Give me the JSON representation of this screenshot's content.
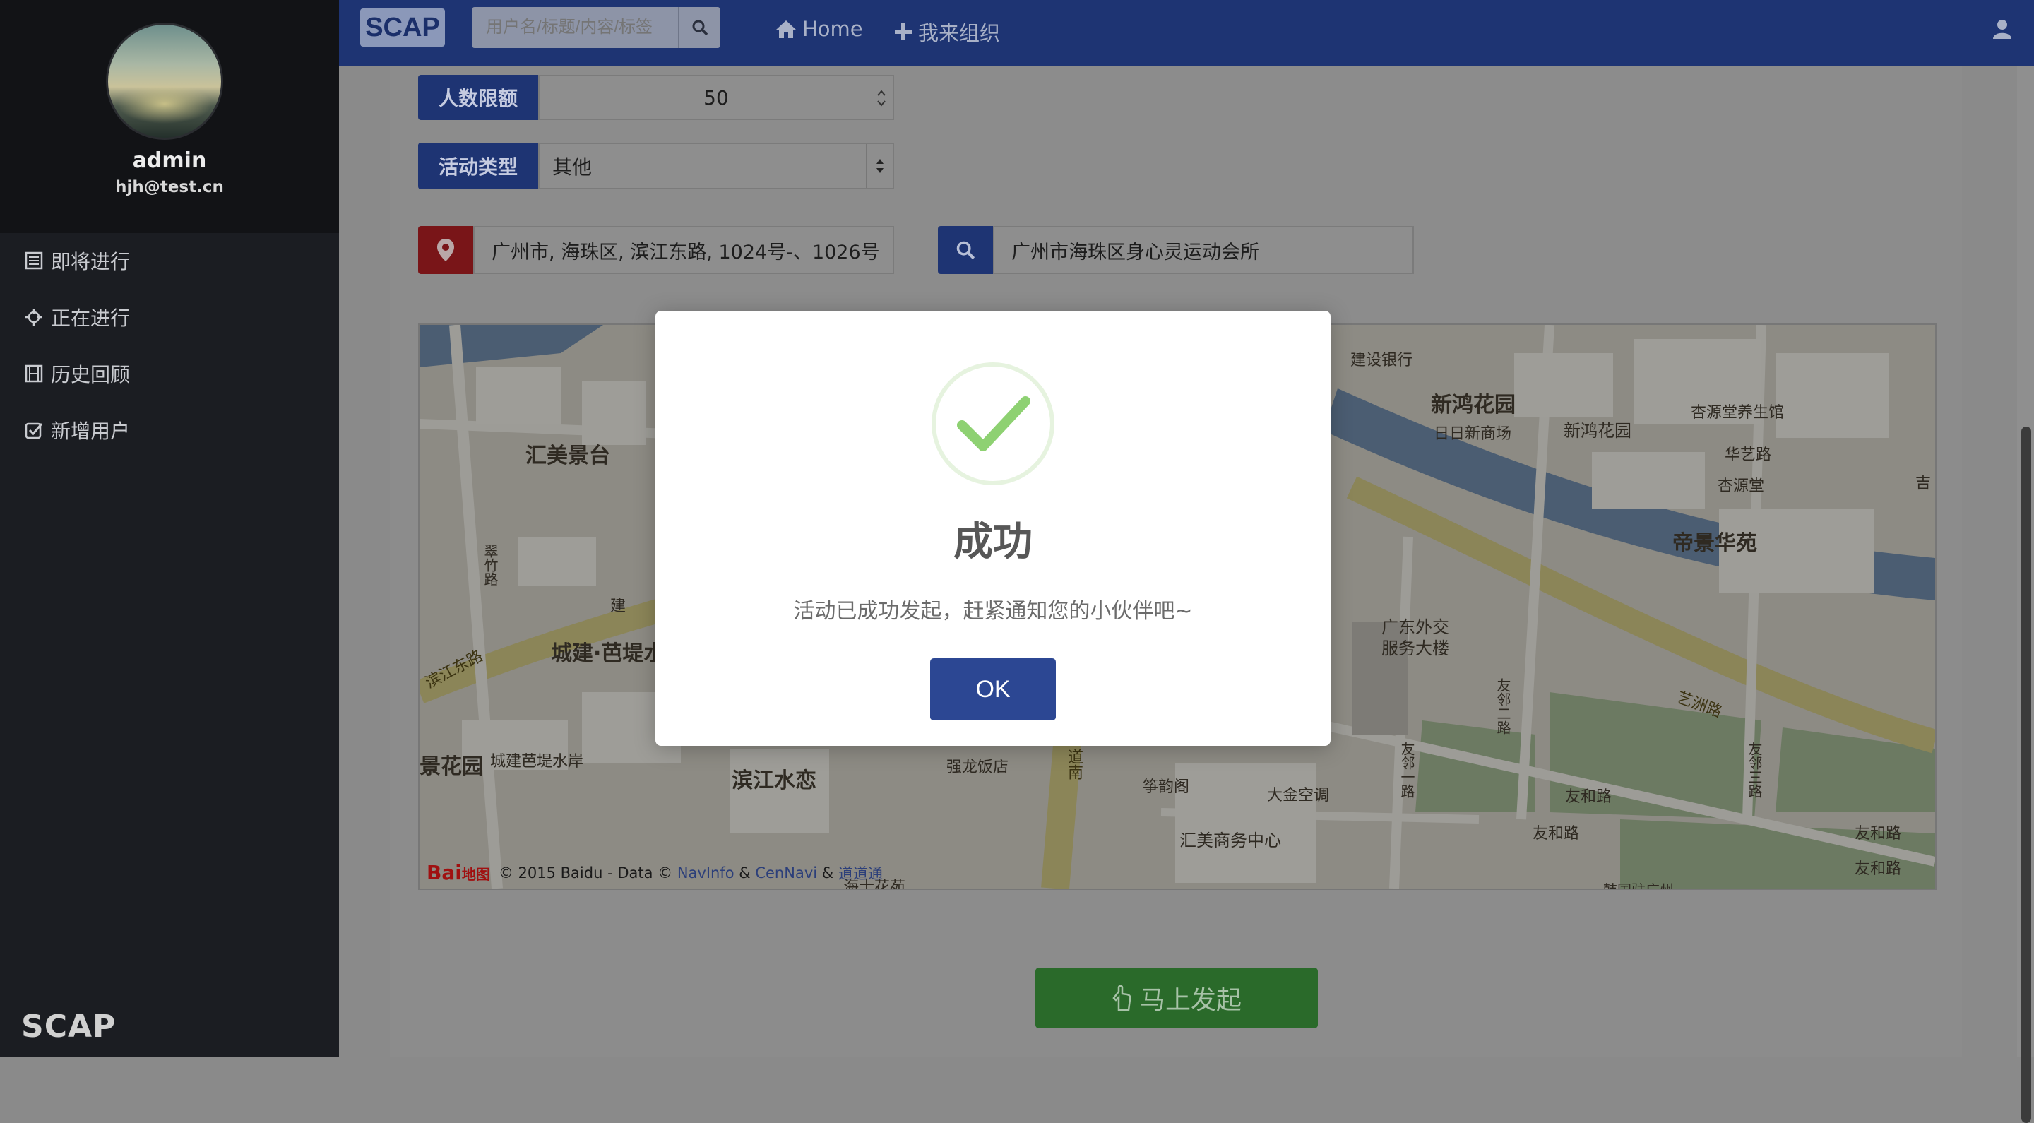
{
  "sidebar": {
    "user_name": "admin",
    "user_email": "hjh@test.cn",
    "items": [
      {
        "label": "即将进行",
        "icon": "list-icon"
      },
      {
        "label": "正在进行",
        "icon": "crosshair-icon"
      },
      {
        "label": "历史回顾",
        "icon": "film-icon"
      },
      {
        "label": "新增用户",
        "icon": "check-square-icon"
      }
    ],
    "brand": "SCAP"
  },
  "topbar": {
    "logo": "SCAP",
    "search_placeholder": "用户名/标题/内容/标签",
    "home_label": "Home",
    "organize_label": "我来组织",
    "colors": {
      "bar": "#1e3473"
    }
  },
  "form": {
    "capacity_label": "人数限额",
    "capacity_value": "50",
    "type_label": "活动类型",
    "type_value": "其他",
    "address_value": "广州市, 海珠区, 滨江东路, 1024号-、1026号",
    "place_value": "广州市海珠区身心灵运动会所",
    "submit_label": "马上发起"
  },
  "map": {
    "labels": {
      "huimei": "汇美景台",
      "chengjian": "城建·芭堤水",
      "jinghuayuan": "景花园",
      "chengjian_an": "城建芭堤水岸",
      "binjiang_shuilian": "滨江水恋",
      "qianglong": "强龙饭店",
      "zhengyunge": "筝韵阁",
      "dajin": "大金空调",
      "huimei_center": "汇美商务中心",
      "cuizhu": "翠竹路",
      "binjiang_road": "滨江东路",
      "jianshe_bank": "建设银行",
      "jianshe_short": "建",
      "xinhong_big": "新鸿花园",
      "xinhong_small": "新鸿花园",
      "ririxin": "日日新商场",
      "xingyuan_health": "杏源堂养生馆",
      "huayi_road": "华艺路",
      "xingyuan": "杏源堂",
      "ji": "吉",
      "dijing": "帝景华苑",
      "foreign_affairs_1": "广东外交",
      "foreign_affairs_2": "服务大楼",
      "yizhou_road": "艺洲路",
      "youyi_2": "友邻二路",
      "youyi_1": "友邻一路",
      "youyi_3": "友邻三路",
      "youhe_1": "友和路",
      "youhe_2": "友和路",
      "youhe_3": "友和路",
      "youhe_4": "友和路",
      "daonan": "道南",
      "bottom_cut": "海士花苑",
      "bottom_cut2": "韩国驻广州"
    },
    "copyright": "© 2015 Baidu - Data ©",
    "navinfo": "NavInfo",
    "amp": "&",
    "cennavi": "CenNavi",
    "daotong": "道道通",
    "logo_text": "Bai",
    "logo_map": "地图"
  },
  "modal": {
    "title": "成功",
    "message": "活动已成功发起，赶紧通知您的小伙伴吧~",
    "ok_label": "OK",
    "check_color": "#8ed172"
  }
}
